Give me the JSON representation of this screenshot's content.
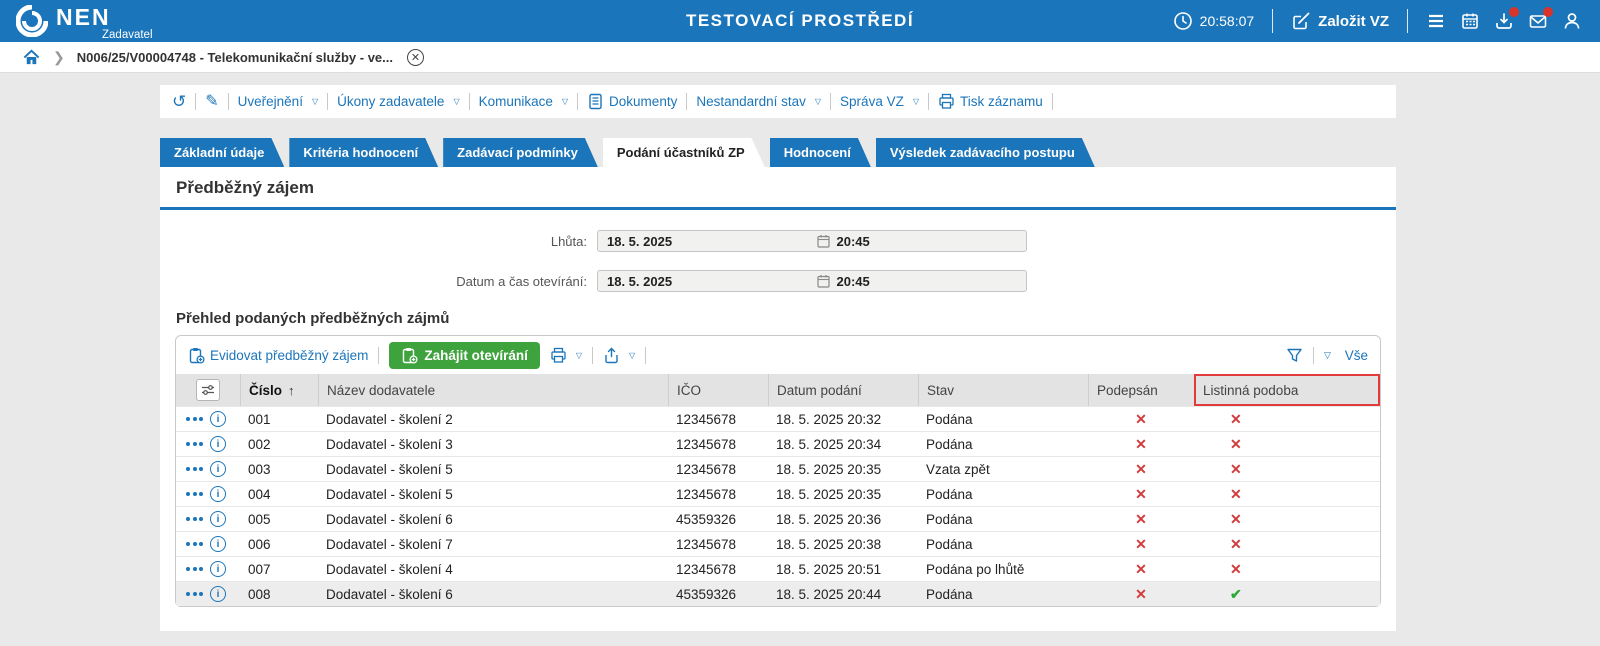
{
  "colors": {
    "accent": "#1b75ba",
    "green": "#3fa33d",
    "red": "#d23b3b",
    "highlight_border": "#e23b3b"
  },
  "icons": {
    "dropdown": "▽",
    "sort_asc": "↑",
    "chevron": "›",
    "refresh": "↺",
    "pencil": "✎",
    "close": "×",
    "hamburger": "☰",
    "info": "i",
    "cross": "✕",
    "check": "✔"
  },
  "header": {
    "logo_text": "NEN",
    "logo_sub": "Zadavatel",
    "env_title": "TESTOVACÍ PROSTŘEDÍ",
    "clock": "20:58:07",
    "create_vz_label": "Založit VZ"
  },
  "breadcrumb": {
    "item": "N006/25/V00004748 - Telekomunikační služby - ve..."
  },
  "actionbar": {
    "items": [
      {
        "label": "Uveřejnění"
      },
      {
        "label": "Úkony zadavatele"
      },
      {
        "label": "Komunikace"
      },
      {
        "label": "Dokumenty"
      },
      {
        "label": "Nestandardní stav"
      },
      {
        "label": "Správa VZ"
      },
      {
        "label": "Tisk záznamu"
      }
    ]
  },
  "tabs": [
    {
      "label": "Základní údaje"
    },
    {
      "label": "Kritéria hodnocení"
    },
    {
      "label": "Zadávací podmínky"
    },
    {
      "label": "Podání účastníků ZP"
    },
    {
      "label": "Hodnocení"
    },
    {
      "label": "Výsledek zadávacího postupu"
    }
  ],
  "section": {
    "title": "Předběžný zájem",
    "fields": [
      {
        "label": "Lhůta:",
        "date": "18. 5. 2025",
        "time": "20:45"
      },
      {
        "label": "Datum a čas otevírání:",
        "date": "18. 5. 2025",
        "time": "20:45"
      }
    ]
  },
  "table": {
    "title": "Přehled podaných předběžných zájmů",
    "toolbar": {
      "evidovat_label": "Evidovat předběžný zájem",
      "zahajit_label": "Zahájit otevírání",
      "filter_all_label": "Vše"
    },
    "columns": [
      "Číslo",
      "Název dodavatele",
      "IČO",
      "Datum podání",
      "Stav",
      "Podepsán",
      "Listinná podoba"
    ],
    "rows": [
      {
        "cislo": "001",
        "nazev": "Dodavatel - školení 2",
        "ico": "12345678",
        "datum": "18. 5. 2025 20:32",
        "stav": "Podána",
        "podepsan": "✕",
        "listinna": "✕"
      },
      {
        "cislo": "002",
        "nazev": "Dodavatel - školení 3",
        "ico": "12345678",
        "datum": "18. 5. 2025 20:34",
        "stav": "Podána",
        "podepsan": "✕",
        "listinna": "✕"
      },
      {
        "cislo": "003",
        "nazev": "Dodavatel - školení 5",
        "ico": "12345678",
        "datum": "18. 5. 2025 20:35",
        "stav": "Vzata zpět",
        "podepsan": "✕",
        "listinna": "✕"
      },
      {
        "cislo": "004",
        "nazev": "Dodavatel - školení 5",
        "ico": "12345678",
        "datum": "18. 5. 2025 20:35",
        "stav": "Podána",
        "podepsan": "✕",
        "listinna": "✕"
      },
      {
        "cislo": "005",
        "nazev": "Dodavatel - školení 6",
        "ico": "45359326",
        "datum": "18. 5. 2025 20:36",
        "stav": "Podána",
        "podepsan": "✕",
        "listinna": "✕"
      },
      {
        "cislo": "006",
        "nazev": "Dodavatel - školení 7",
        "ico": "12345678",
        "datum": "18. 5. 2025 20:38",
        "stav": "Podána",
        "podepsan": "✕",
        "listinna": "✕"
      },
      {
        "cislo": "007",
        "nazev": "Dodavatel - školení 4",
        "ico": "12345678",
        "datum": "18. 5. 2025 20:51",
        "stav": "Podána po lhůtě",
        "podepsan": "✕",
        "listinna": "✕"
      },
      {
        "cislo": "008",
        "nazev": "Dodavatel - školení 6",
        "ico": "45359326",
        "datum": "18. 5. 2025 20:44",
        "stav": "Podána",
        "podepsan": "✕",
        "listinna": "✔",
        "selected": true
      }
    ]
  }
}
